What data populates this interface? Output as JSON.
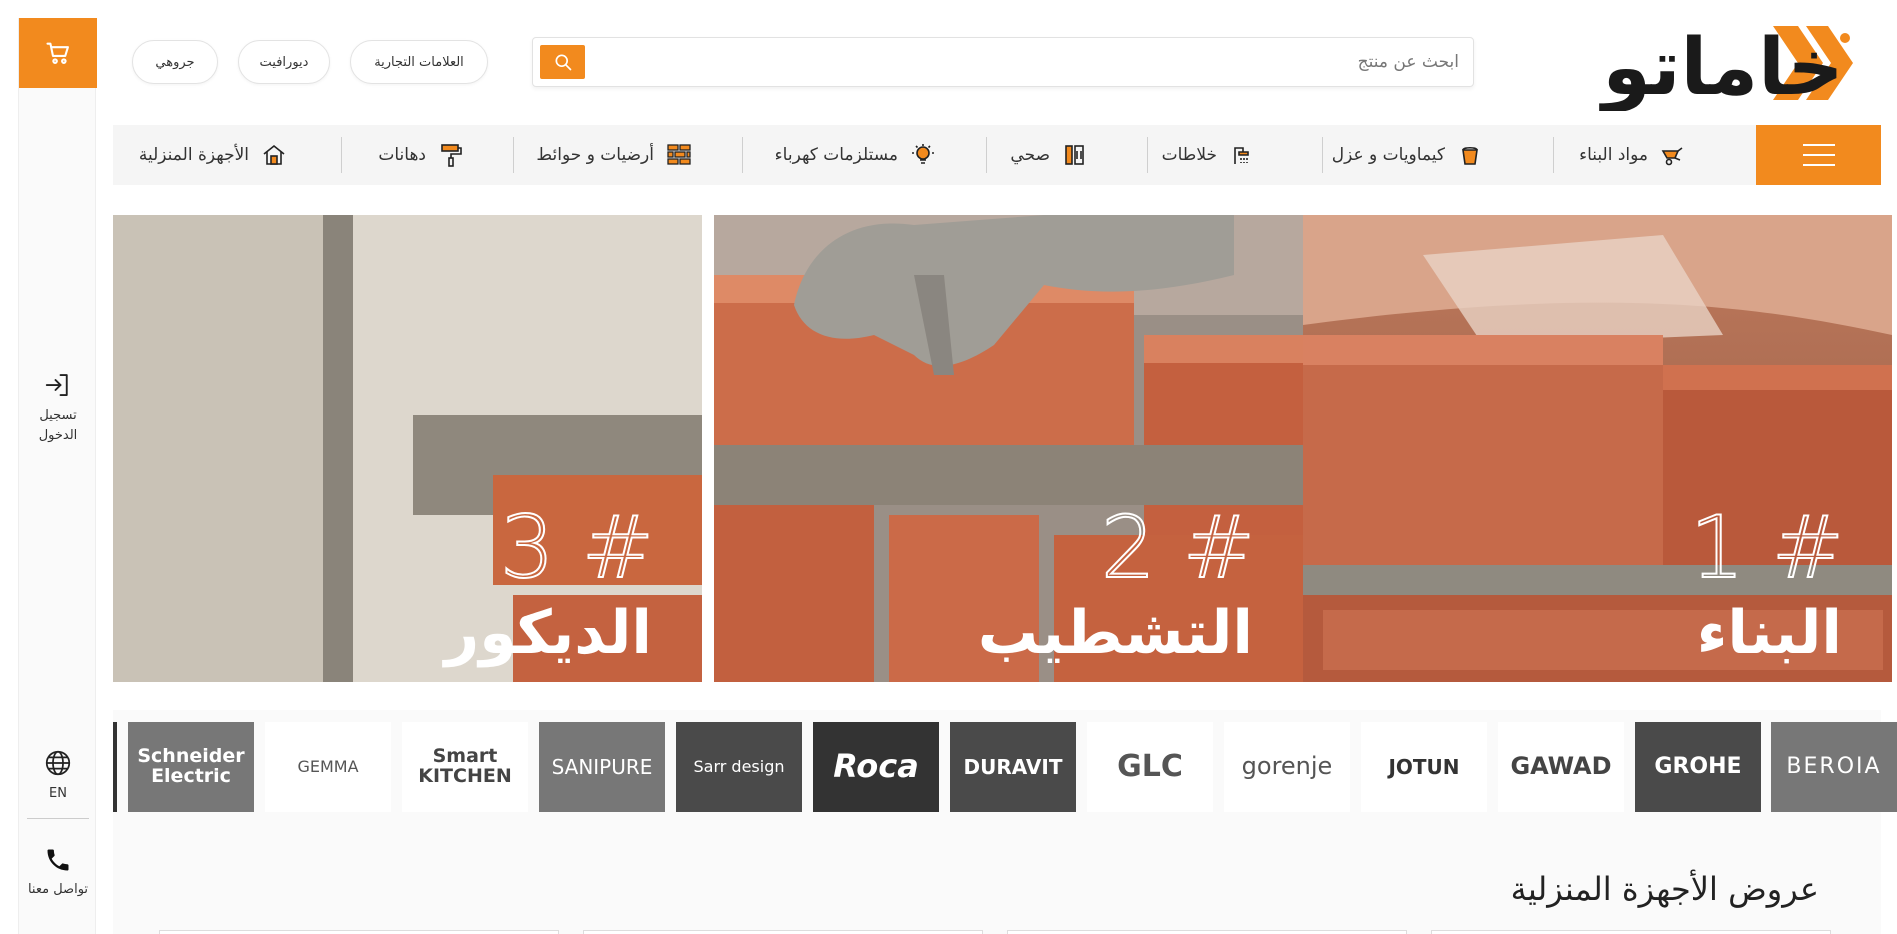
{
  "rail": {
    "login_label": "تسجيل الدخول",
    "lang_label": "EN",
    "contact_label": "تواصل معنا"
  },
  "header": {
    "logo_text": "خاماتو",
    "search_placeholder": "ابحث عن منتج",
    "chips": [
      "العلامات التجارية",
      "ديورافيت",
      "جروهي"
    ]
  },
  "categories": [
    {
      "label": "مواد البناء",
      "icon": "wheelbarrow-icon"
    },
    {
      "label": "كيماويات و عزل",
      "icon": "bucket-icon"
    },
    {
      "label": "خلاطات",
      "icon": "shower-icon"
    },
    {
      "label": "صحي",
      "icon": "bathroom-icon"
    },
    {
      "label": "مستلزمات كهرباء",
      "icon": "bulb-icon"
    },
    {
      "label": "أرضيات و حوائط",
      "icon": "bricks-icon"
    },
    {
      "label": "دهانات",
      "icon": "paint-roller-icon"
    },
    {
      "label": "الأجهزة المنزلية",
      "icon": "home-appliance-icon"
    }
  ],
  "banners": [
    {
      "num": "1 #",
      "title": "البناء"
    },
    {
      "num": "2 #",
      "title": "التشطيب"
    },
    {
      "num": "3 #",
      "title": "الديكور"
    }
  ],
  "brands": [
    "BEROIA",
    "GROHE",
    "GAWAD",
    "JOTUN",
    "gorenje",
    "GLC",
    "DURAVIT",
    "Roca",
    "Sarr design",
    "SANIPURE",
    "Smart KITCHEN",
    "GEMMA",
    "Schneider Electric"
  ],
  "section": {
    "title": "عروض الأجهزة المنزلية"
  },
  "colors": {
    "accent": "#f28a1e"
  }
}
